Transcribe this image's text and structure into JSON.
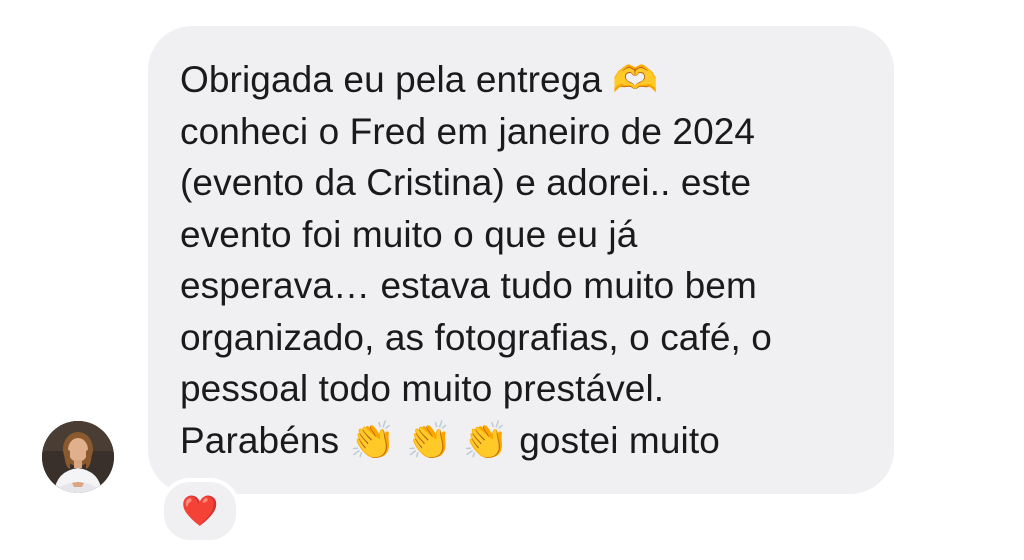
{
  "message": {
    "text": "Obrigada eu pela entrega 🫶\nconheci o Fred em janeiro de 2024\n(evento da Cristina) e adorei.. este\nevento foi muito o que eu já\nesperava… estava tudo muito bem\norganizado, as fotografias, o café, o\npessoal todo muito prestável.\nParabéns 👏 👏 👏 gostei muito"
  },
  "reaction": {
    "emoji": "❤️"
  },
  "avatar": {
    "icon": "user-avatar-photo"
  }
}
